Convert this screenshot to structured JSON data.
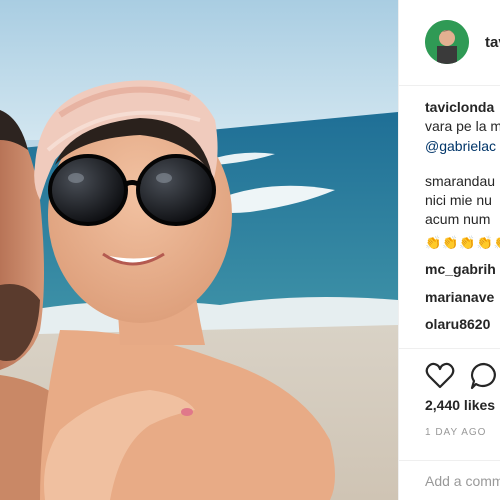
{
  "post": {
    "author": "tavic",
    "image_icon": "beach-selfie-photo"
  },
  "comments": [
    {
      "line": "taviclonda",
      "kind": "username"
    },
    {
      "line": "vara pe la m",
      "kind": "text"
    },
    {
      "line": "@gabrielac",
      "kind": "mention"
    },
    {
      "line": "smarandau",
      "kind": "text"
    },
    {
      "line": "nici mie nu",
      "kind": "text"
    },
    {
      "line": "acum num",
      "kind": "text"
    },
    {
      "line": "👏👏👏👏👏",
      "kind": "emoji"
    },
    {
      "line": "mc_gabrih",
      "kind": "username"
    },
    {
      "line": "marianave",
      "kind": "username"
    },
    {
      "line": "olaru8620",
      "kind": "username"
    }
  ],
  "actions": {
    "like_icon": "heart-icon",
    "comment_icon": "comment-bubble-icon"
  },
  "likes_text": "2,440 likes",
  "timestamp": "1 DAY AGO",
  "add_comment_placeholder": "Add a comment..."
}
